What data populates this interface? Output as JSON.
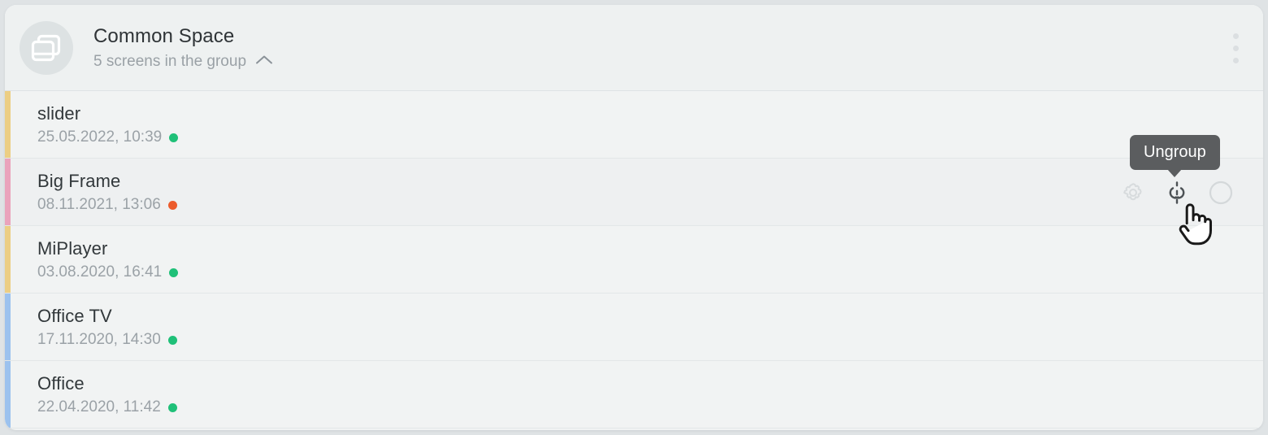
{
  "header": {
    "avatar_icon": "screens-stack-icon",
    "title": "Common Space",
    "subtitle": "5 screens in the group",
    "collapse_icon": "chevron-up-icon",
    "menu_icon": "more-vertical-icon"
  },
  "tooltip": {
    "label": "Ungroup"
  },
  "actions": {
    "settings_icon": "gear-icon",
    "ungroup_icon": "broken-link-icon",
    "select_icon": "circle-unchecked-icon"
  },
  "cursor": {
    "type": "pointing-hand-cursor"
  },
  "colors": {
    "page_background": "#dfe3e5",
    "card_background": "#f1f3f3",
    "header_background": "#eef1f1",
    "row_hover_background": "#eef0f1",
    "divider": "#e3e7e8",
    "title_text": "#2f3437",
    "muted_text": "#9ba2a7",
    "status_online": "#1fc078",
    "status_offline": "#ec5b2c",
    "tooltip_background": "#5b5d5f",
    "tooltip_text": "#ffffff",
    "icon_muted": "#d7dbdd"
  },
  "screens": [
    {
      "name": "slider",
      "date": "25.05.2022, 10:39",
      "status": "online",
      "status_color": "#1fc078",
      "bar_color": "#ecce84",
      "hovered": false
    },
    {
      "name": "Big Frame",
      "date": "08.11.2021, 13:06",
      "status": "offline",
      "status_color": "#ec5b2c",
      "bar_color": "#eaa3bc",
      "hovered": true
    },
    {
      "name": "MiPlayer",
      "date": "03.08.2020, 16:41",
      "status": "online",
      "status_color": "#1fc078",
      "bar_color": "#ecce84",
      "hovered": false
    },
    {
      "name": "Office TV",
      "date": "17.11.2020, 14:30",
      "status": "online",
      "status_color": "#1fc078",
      "bar_color": "#9cc2ee",
      "hovered": false
    },
    {
      "name": "Office",
      "date": "22.04.2020, 11:42",
      "status": "online",
      "status_color": "#1fc078",
      "bar_color": "#9cc2ee",
      "hovered": false
    }
  ]
}
